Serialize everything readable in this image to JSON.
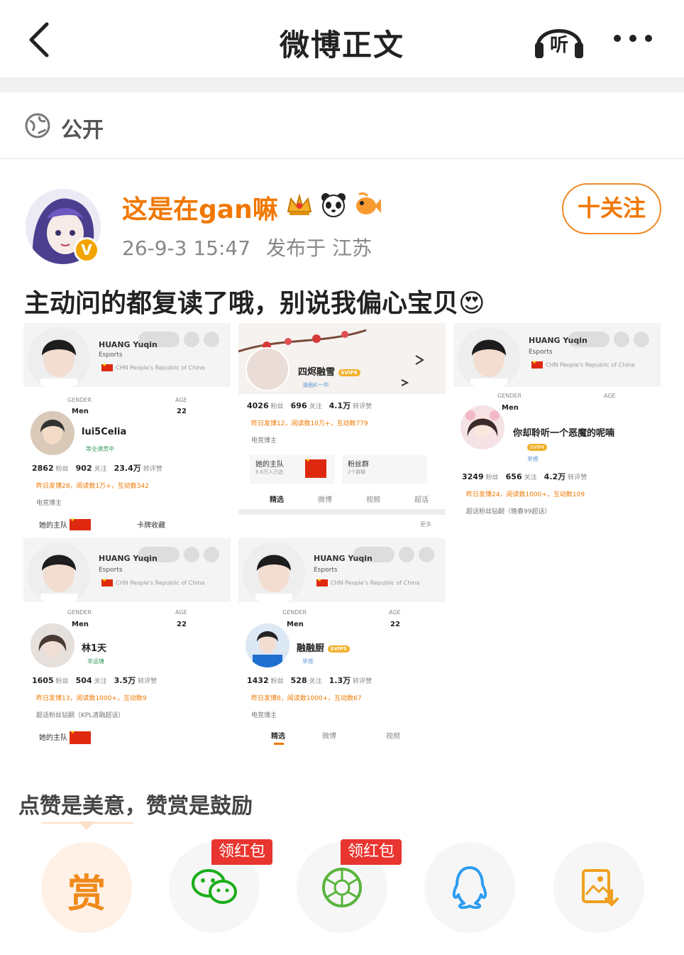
{
  "nav": {
    "title": "微博正文",
    "listen_label": "听"
  },
  "visibility": {
    "label": "公开"
  },
  "post": {
    "author": "这是在gan嘛",
    "time": "26-9-3 15:47",
    "location": "发布于 江苏",
    "follow_label": "十关注",
    "text": "主动问的都复读了哦，别说我偏心宝贝",
    "emoji": "😍"
  },
  "shots": [
    {
      "profile_name": "HUANG Yuqin",
      "profile_sub": "Esports",
      "country": "CHN People's Republic of China",
      "gender_label": "GENDER",
      "gender": "Men",
      "age_label": "AGE",
      "age": "22",
      "user": "lui5Celia",
      "user_sub": "等全满贯中",
      "fans": "2862",
      "fans_l": "粉丝",
      "follow": "902",
      "follow_l": "关注",
      "likes": "23.4万",
      "likes_l": "转评赞",
      "activity": "昨日发博28，阅读数1万+，互动数342",
      "tag": "电竞博主",
      "chip1": "她的主队",
      "chip2": "卡牌收藏"
    },
    {
      "user": "四烬融雪",
      "user_sub": "清融K一中",
      "fans": "4026",
      "fans_l": "粉丝",
      "follow": "696",
      "follow_l": "关注",
      "likes": "4.1万",
      "likes_l": "转评赞",
      "activity": "昨日发博12，阅读数10万+，互动数779",
      "tag": "电竞博主",
      "chip1": "她的主队",
      "chip1_sub": "6.8万人已选",
      "chip2": "粉丝群",
      "chip2_sub": "2个群聊",
      "tab1": "精选",
      "tab2": "微博",
      "tab3": "视频",
      "tab4": "超话",
      "more": "更多"
    },
    {
      "profile_name": "HUANG Yuqin",
      "profile_sub": "Esports",
      "country": "CHN People's Republic of China",
      "gender_label": "GENDER",
      "gender": "Men",
      "age_label": "AGE",
      "user": "你却聆听一个恶魔的呢喃",
      "user_sub": "单推",
      "fans": "3249",
      "fans_l": "粉丝",
      "follow": "656",
      "follow_l": "关注",
      "likes": "4.2万",
      "likes_l": "转评赞",
      "activity": "昨日发博24，阅读数1000+，互动数109",
      "tag": "超话粉丝钻嗣（晚春99超话）"
    },
    {
      "profile_name": "HUANG Yuqin",
      "profile_sub": "Esports",
      "country": "CHN People's Republic of China",
      "gender_label": "GENDER",
      "gender": "Men",
      "age_label": "AGE",
      "age": "22",
      "user": "林1天",
      "user_sub": "幸运塘",
      "fans": "1605",
      "fans_l": "粉丝",
      "follow": "504",
      "follow_l": "关注",
      "likes": "3.5万",
      "likes_l": "转评赞",
      "activity": "昨日发博13，阅读数1000+，互动数9",
      "tag": "超话粉丝钻嗣（KPL清融超话）",
      "chip1": "她的主队"
    },
    {
      "profile_name": "HUANG Yuqin",
      "profile_sub": "Esports",
      "country": "CHN People's Republic of China",
      "gender_label": "GENDER",
      "gender": "Men",
      "age_label": "AGE",
      "age": "22",
      "user": "融融厨",
      "user_sub": "单推",
      "fans": "1432",
      "fans_l": "粉丝",
      "follow": "528",
      "follow_l": "关注",
      "likes": "1.3万",
      "likes_l": "转评赞",
      "activity": "昨日发博8，阅读数1000+，互动数67",
      "tag": "电竞博主",
      "tab1": "精选",
      "tab2": "微博",
      "tab3": "视频"
    }
  ],
  "reward": {
    "encourage_text": "点赞是美意，赞赏是鼓励",
    "reward_label": "赏",
    "redpacket_label": "领红包"
  },
  "colors": {
    "accent": "#f07800",
    "wechat": "#1aad19",
    "moments": "#59b43c",
    "qq": "#2d9cf0",
    "save": "#f0a020"
  }
}
